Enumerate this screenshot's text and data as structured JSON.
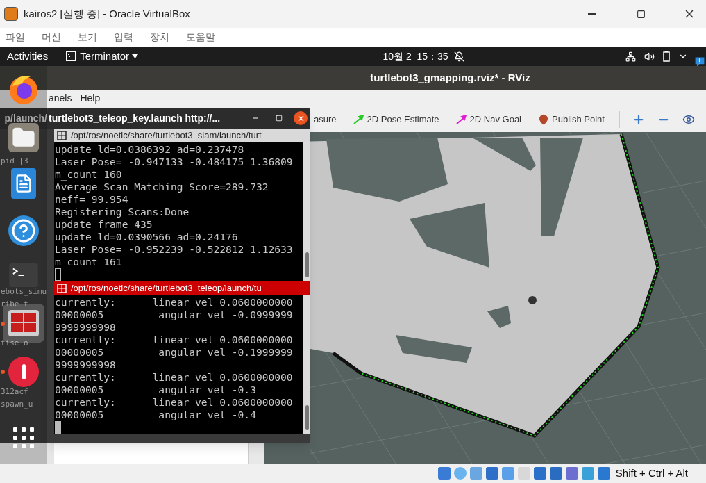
{
  "vbox_window": {
    "title": "kairos2 [실행 중] - Oracle VirtualBox",
    "menu": [
      "파일",
      "머신",
      "보기",
      "입력",
      "장치",
      "도움말"
    ]
  },
  "top_bar": {
    "activities": "Activities",
    "app_menu": "Terminator",
    "clock": "10월 2  15：35"
  },
  "dock": [
    {
      "kind": "browser",
      "running": false,
      "selected": false
    },
    {
      "kind": "files",
      "running": false,
      "selected": false
    },
    {
      "kind": "writer",
      "running": false,
      "selected": false
    },
    {
      "kind": "help",
      "running": false,
      "selected": false
    },
    {
      "kind": "terminal",
      "running": false,
      "selected": false
    },
    {
      "kind": "terminator",
      "running": true,
      "selected": true
    },
    {
      "kind": "error",
      "running": true,
      "selected": false
    },
    {
      "kind": "apps",
      "running": false,
      "selected": false
    }
  ],
  "background_terminal": {
    "title": "p/launch/",
    "fragments": [
      "pid [3",
      "ebots_simu",
      "ribe t",
      "tise o",
      "312acf",
      "spawn_u"
    ]
  },
  "rviz": {
    "title": "turtlebot3_gmapping.rviz* - RViz",
    "menu": [
      "anels",
      "Help"
    ],
    "tools": [
      {
        "label": "asure",
        "kind": "plain"
      },
      {
        "label": "2D Pose Estimate",
        "kind": "pose"
      },
      {
        "label": "2D Nav Goal",
        "kind": "goal"
      },
      {
        "label": "Publish Point",
        "kind": "point"
      }
    ]
  },
  "terminal": {
    "title": "turtlebot3_teleop_key.launch http://...",
    "panes": [
      {
        "path": "/opt/ros/noetic/share/turtlebot3_slam/launch/turt",
        "selected": false,
        "lines": [
          "update ld=0.0386392 ad=0.237478",
          "Laser Pose= -0.947133 -0.484175 1.36809",
          "m_count 160",
          "Average Scan Matching Score=289.732",
          "neff= 99.954",
          "Registering Scans:Done",
          "update frame 435",
          "update ld=0.0390566 ad=0.24176",
          "Laser Pose= -0.952239 -0.522812 1.12633",
          "m_count 161"
        ]
      },
      {
        "path": "/opt/ros/noetic/share/turtlebot3_teleop/launch/tu",
        "selected": true,
        "lines": [
          "currently:      linear vel 0.0600000000",
          "00000005         angular vel -0.0999999",
          "9999999998",
          "currently:      linear vel 0.0600000000",
          "00000005         angular vel -0.1999999",
          "9999999998",
          "currently:      linear vel 0.0600000000",
          "00000005         angular vel -0.3",
          "currently:      linear vel 0.0600000000",
          "00000005         angular vel -0.4"
        ]
      }
    ]
  },
  "status_bar": {
    "host_key": "Shift + Ctrl + Alt"
  }
}
